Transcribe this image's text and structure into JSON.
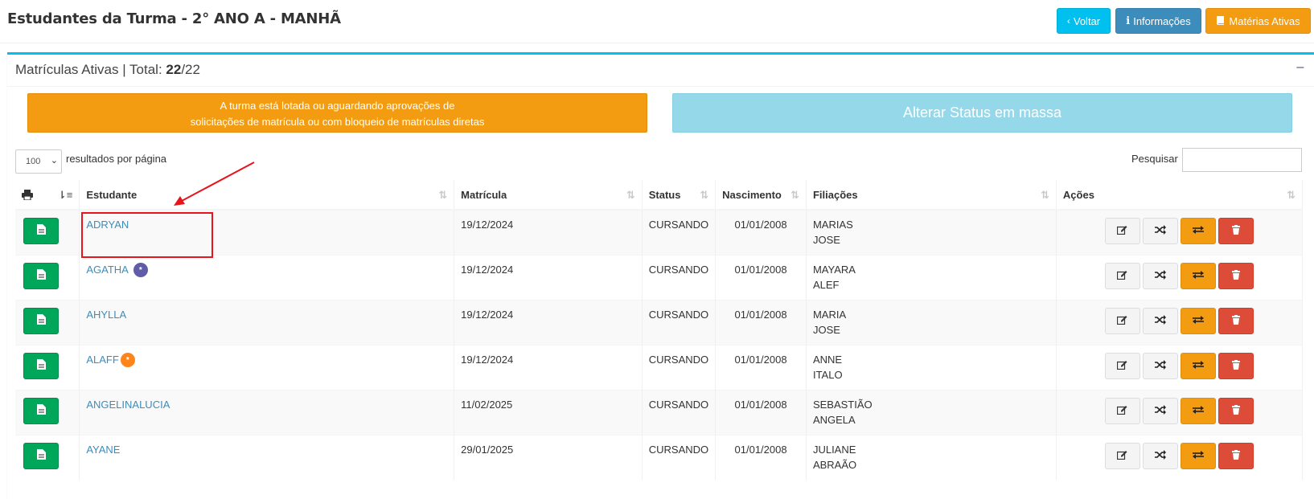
{
  "header": {
    "title": "Estudantes da Turma - 2° ANO A - MANHÃ",
    "buttons": {
      "voltar": "Voltar",
      "informacoes": "Informações",
      "materias": "Matérias Ativas"
    }
  },
  "box": {
    "title_prefix": "Matrículas Ativas | Total: ",
    "total_count": "22",
    "total_suffix": "/22",
    "collapse_symbol": "−"
  },
  "banner": {
    "line1": "A turma está lotada ou aguardando aprovações de",
    "line2": "solicitações de matrícula ou com bloqueio de matrículas diretas"
  },
  "mass_status_button": "Alterar Status em massa",
  "length_menu": {
    "selected": "100",
    "label": "resultados por página"
  },
  "search": {
    "label": "Pesquisar",
    "value": ""
  },
  "table": {
    "headers": {
      "estudante": "Estudante",
      "matricula": "Matrícula",
      "status": "Status",
      "nascimento": "Nascimento",
      "filiacoes": "Filiações",
      "acoes": "Ações"
    },
    "rows": [
      {
        "name": "ADRYAN",
        "badge": "",
        "matricula": "19/12/2024",
        "status": "CURSANDO",
        "nascimento": "01/01/2008",
        "filiacao1": "MARIAS",
        "filiacao2": "JOSE"
      },
      {
        "name": "AGATHA",
        "badge": "*",
        "matricula": "19/12/2024",
        "status": "CURSANDO",
        "nascimento": "01/01/2008",
        "filiacao1": "MAYARA",
        "filiacao2": "ALEF"
      },
      {
        "name": "AHYLLA",
        "badge": "",
        "matricula": "19/12/2024",
        "status": "CURSANDO",
        "nascimento": "01/01/2008",
        "filiacao1": "MARIA",
        "filiacao2": "JOSE"
      },
      {
        "name": "ALAFF",
        "badge": "*",
        "matricula": "19/12/2024",
        "status": "CURSANDO",
        "nascimento": "01/01/2008",
        "filiacao1": "ANNE",
        "filiacao2": "ITALO"
      },
      {
        "name": "ANGELINALUCIA",
        "badge": "",
        "matricula": "11/02/2025",
        "status": "CURSANDO",
        "nascimento": "01/01/2008",
        "filiacao1": "SEBASTIÃO",
        "filiacao2": "ANGELA"
      },
      {
        "name": "AYANE",
        "badge": "",
        "matricula": "29/01/2025",
        "status": "CURSANDO",
        "nascimento": "01/01/2008",
        "filiacao1": "JULIANE",
        "filiacao2": "ABRAÃO"
      }
    ]
  },
  "colors": {
    "info": "#00c0ef",
    "primary": "#3c8dbc",
    "warning": "#f39c12",
    "success": "#00a65a",
    "danger": "#dd4b39",
    "link": "#3c8dbc",
    "annotation": "#e8141b",
    "badge_purple": "#605ca8",
    "badge_orange": "#ff851b"
  }
}
